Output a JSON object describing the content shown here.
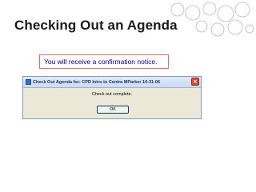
{
  "slide": {
    "title": "Checking Out an Agenda",
    "note": "You will receive a confirmation notice."
  },
  "dialog": {
    "title": "Check Out Agenda for: CPD Intro to Centra MParker 10-31-06",
    "message": "Check out complete.",
    "ok_label": "OK",
    "close_label": "×",
    "title_icon": "app-icon"
  },
  "colors": {
    "title_text": "#1a1a1a",
    "note_text": "#000080",
    "note_border": "#e07070",
    "dialog_body": "#ece9d8",
    "close_button": "#d84a2f"
  }
}
